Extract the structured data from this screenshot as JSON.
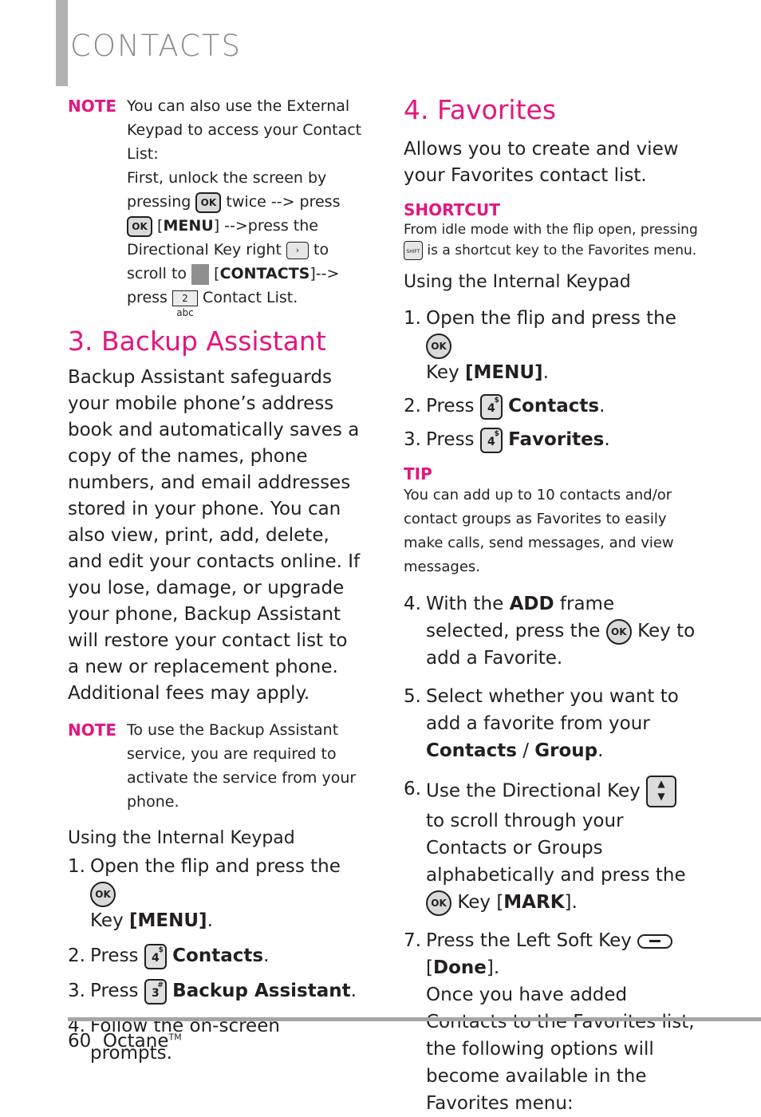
{
  "header": {
    "chapter_title": "CONTACTS"
  },
  "left": {
    "note1": {
      "label": "NOTE",
      "line1": "You can also use the External Keypad to access your Contact List:",
      "line2a": "First, unlock the screen by pressing",
      "line2b": "twice --> press",
      "line2c": "[",
      "menu": "MENU",
      "line2d": "] -->press the Directional Key right",
      "line2e": "to scroll to",
      "line2f": "[",
      "contacts": "CONTACTS",
      "line2g": "]-->",
      "line2h": "press",
      "line2i": "Contact List.",
      "key_ok": "OK",
      "key_right": "›",
      "key_2": "2 abc"
    },
    "section_title": "3. Backup Assistant",
    "body": "Backup Assistant safeguards your mobile phone’s address book and automatically saves a copy of the names, phone numbers, and email addresses stored in your phone. You can also view, print, add, delete, and edit your contacts online. If you lose, damage, or upgrade your phone, Backup Assistant will restore your contact list to a new or replacement phone. Additional fees may apply.",
    "note2": {
      "label": "NOTE",
      "text": "To use the Backup Assistant service, you are required to activate the service from your phone."
    },
    "subheading": "Using the Internal Keypad",
    "steps": [
      {
        "n": "1.",
        "pre": "Open the flip and press the",
        "key": "OK",
        "post": "Key ",
        "bold": "[MENU]",
        "end": "."
      },
      {
        "n": "2.",
        "pre": "Press",
        "key": "4",
        "sup": "$",
        "bold": "Contacts",
        "end": "."
      },
      {
        "n": "3.",
        "pre": "Press",
        "key": "3",
        "sup": "#",
        "bold": "Backup Assistant",
        "end": "."
      },
      {
        "n": "4.",
        "text": "Follow the on-screen prompts."
      }
    ]
  },
  "right": {
    "section_title": "4. Favorites",
    "intro": "Allows you to create and view your Favorites contact list.",
    "shortcut": {
      "label": "SHORTCUT",
      "line1": "From idle mode with the flip open, pressing",
      "line2": "is a shortcut key  to the Favorites menu.",
      "key": "SHIFT"
    },
    "subheading": "Using the Internal Keypad",
    "steps_a": [
      {
        "n": "1.",
        "pre": "Open the flip and press the",
        "key": "OK",
        "post": "Key ",
        "bold": "[MENU]",
        "end": "."
      },
      {
        "n": "2.",
        "pre": "Press",
        "key": "4",
        "sup": "$",
        "bold": "Contacts",
        "end": "."
      },
      {
        "n": "3.",
        "pre": "Press",
        "key": "4",
        "sup": "$",
        "bold": "Favorites",
        "end": "."
      }
    ],
    "tip": {
      "label": "TIP",
      "text": "You can add up to 10 contacts and/or contact groups as Favorites to easily make calls, send messages, and view messages."
    },
    "steps_b": [
      {
        "n": "4.",
        "pre": "With the ",
        "bold": "ADD",
        "mid": " frame selected, press the",
        "key": "OK",
        "post": "Key to add a Favorite."
      },
      {
        "n": "5.",
        "pre": "Select whether you want to add a favorite from your ",
        "bold": "Contacts",
        "mid": " / ",
        "bold2": "Group",
        "end": "."
      },
      {
        "n": "6.",
        "pre": "Use the Directional Key",
        "post": "to scroll through your Contacts or Groups alphabetically and press the",
        "key": "OK",
        "post2": "Key [",
        "bold": "MARK",
        "end": "]."
      },
      {
        "n": "7.",
        "pre": "Press the Left Soft Key",
        "post": "[",
        "bold": "Done",
        "end": "].",
        "extra": "Once you have added Contacts to the Favorites list, the following options will become available in the Favorites menu:"
      }
    ]
  },
  "footer": {
    "page": "60",
    "product": "Octane",
    "tm": "TM"
  }
}
